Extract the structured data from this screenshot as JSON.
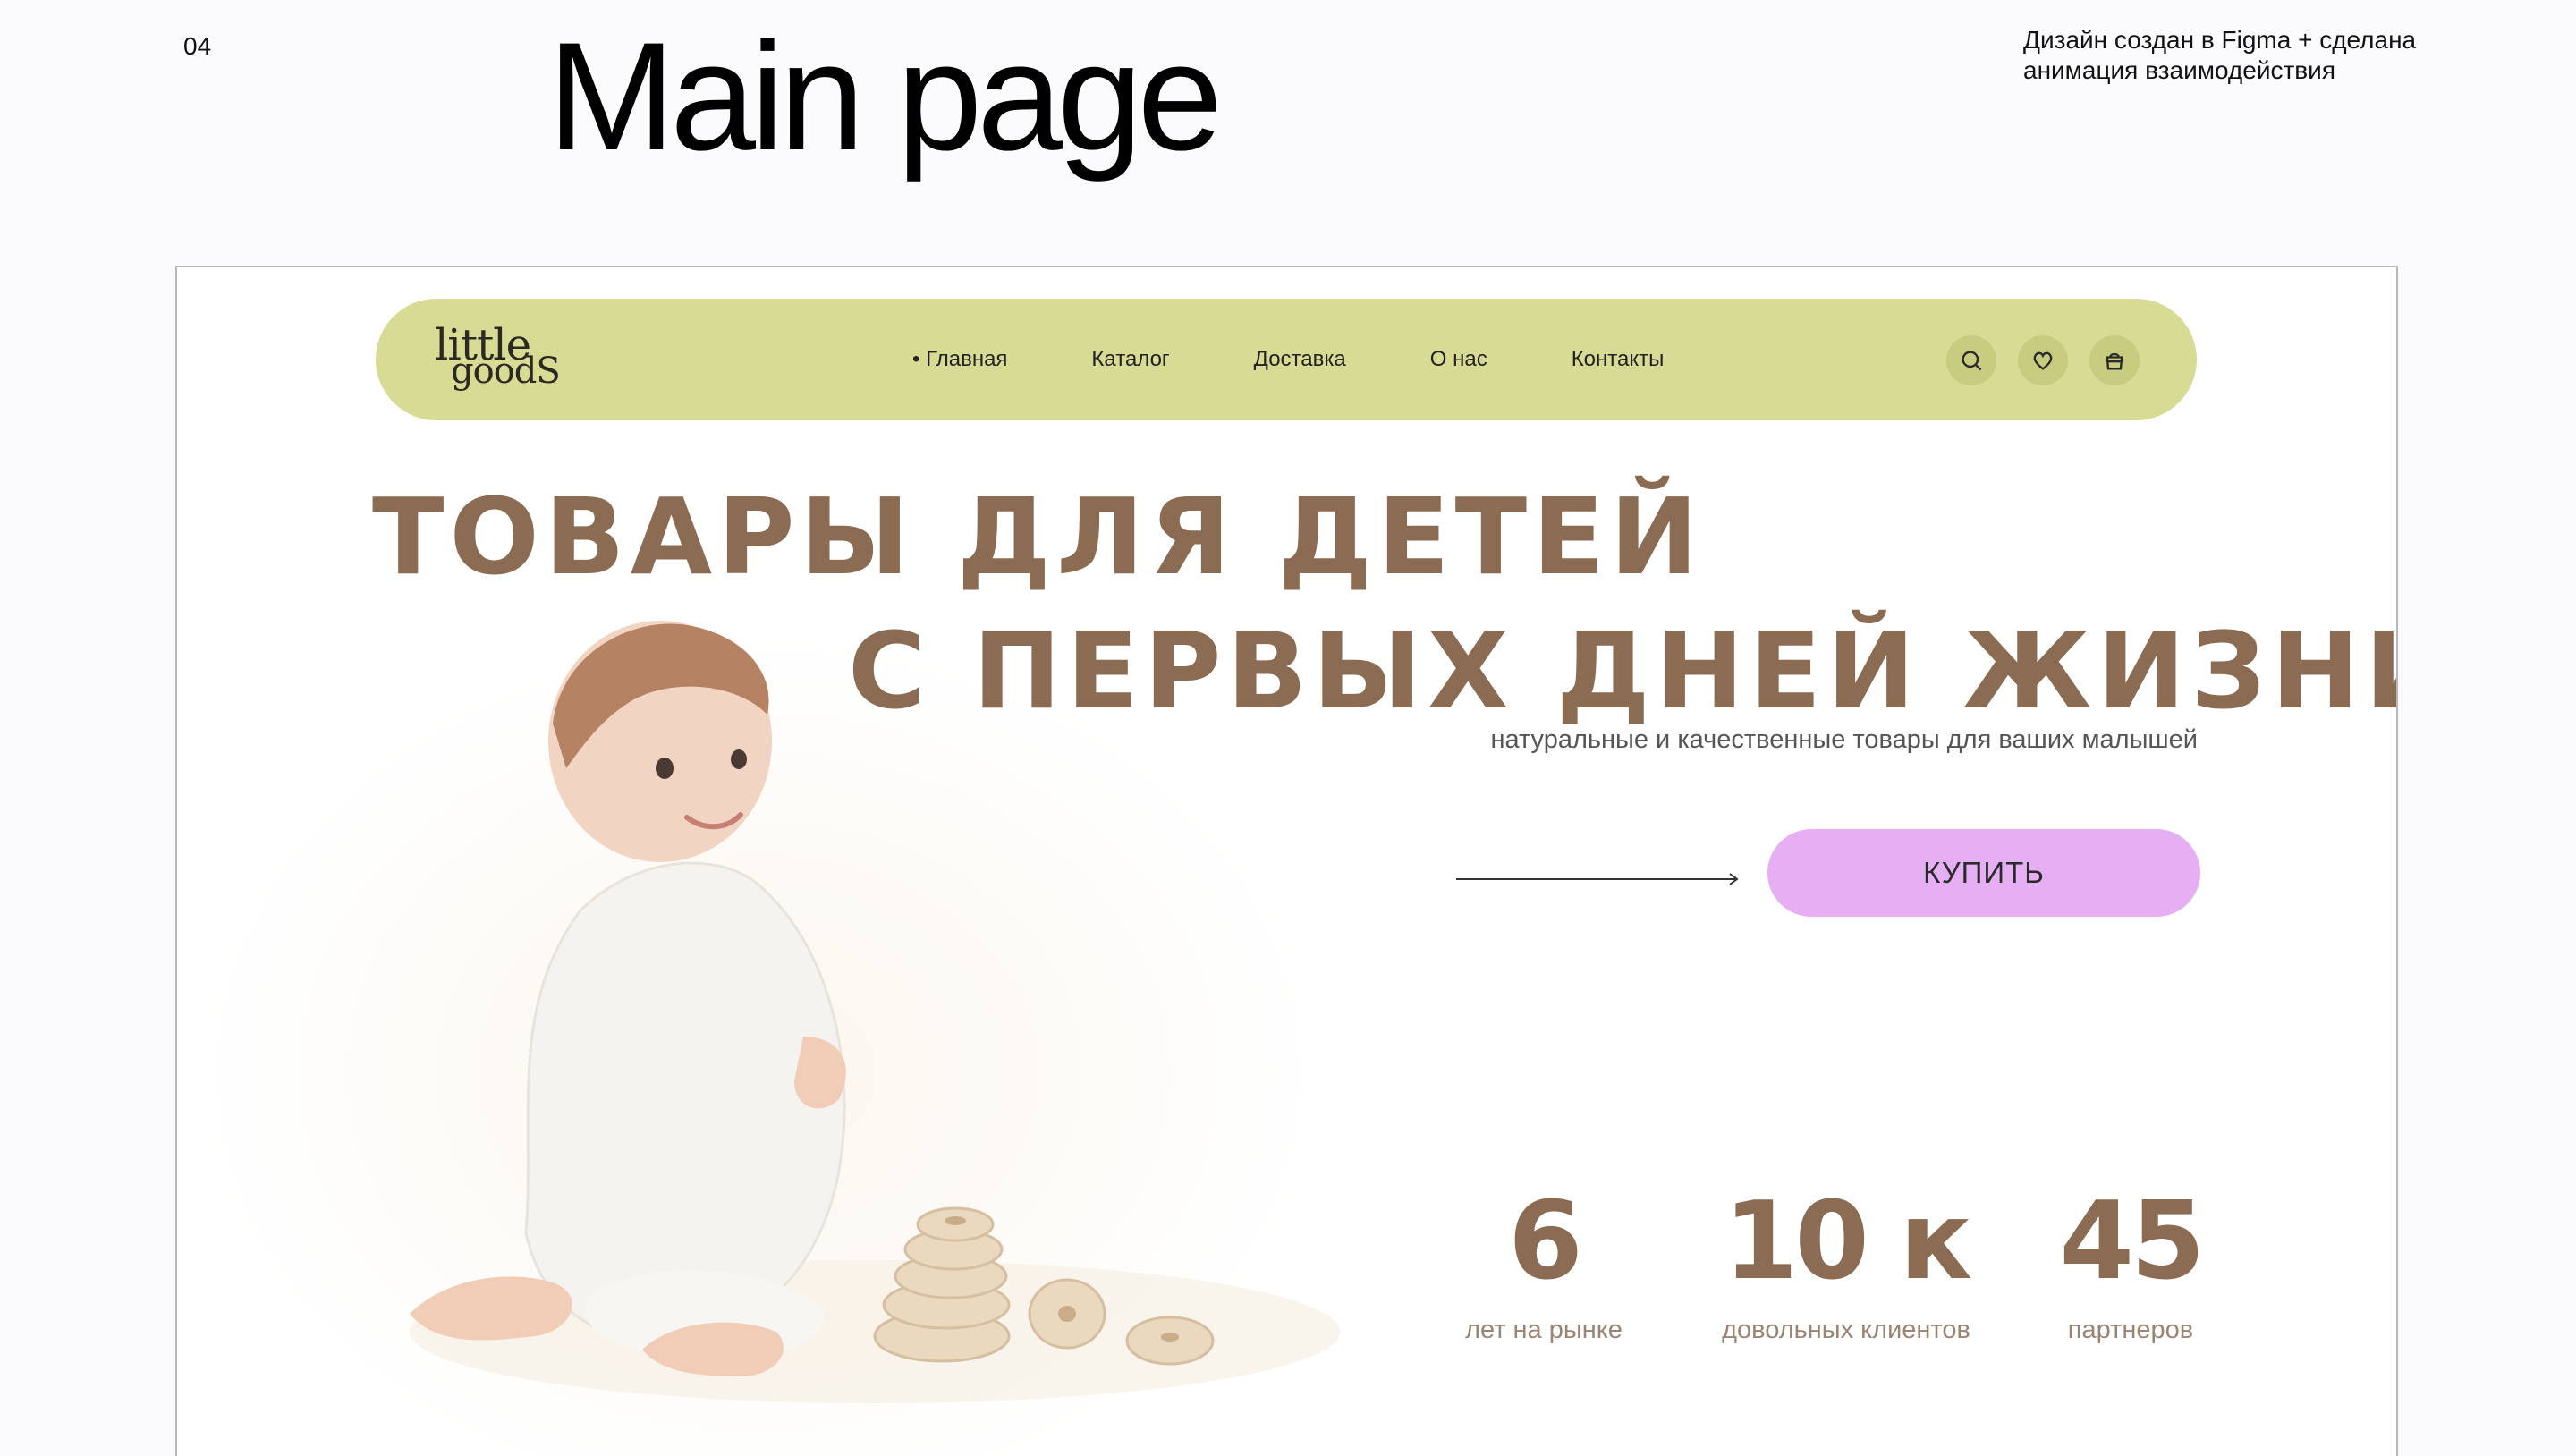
{
  "slide": {
    "number": "04",
    "title": "Main page",
    "note": "Дизайн создан в Figma + сделана анимация взаимодействия"
  },
  "site": {
    "logo": {
      "line1": "little",
      "line2": "goodS"
    },
    "nav": {
      "links": [
        "• Главная",
        "Каталог",
        "Доставка",
        "О нас",
        "Контакты"
      ],
      "icons": [
        "search-icon",
        "heart-icon",
        "basket-icon"
      ]
    },
    "hero": {
      "line1": "ТОВАРЫ ДЛЯ ДЕТЕЙ",
      "line2": "С ПЕРВЫХ ДНЕЙ ЖИЗНИ",
      "subtitle": "натуральные и качественные товары для ваших малышей",
      "button": "КУПИТЬ"
    },
    "stats": [
      {
        "value": "6",
        "label": "лет на рынке"
      },
      {
        "value": "10 к",
        "label": "довольных клиентов"
      },
      {
        "value": "45",
        "label": "партнеров"
      }
    ]
  },
  "colors": {
    "nav_bg": "#d7db93",
    "accent_brown": "#8b6b52",
    "button_bg": "#e6aef3"
  }
}
